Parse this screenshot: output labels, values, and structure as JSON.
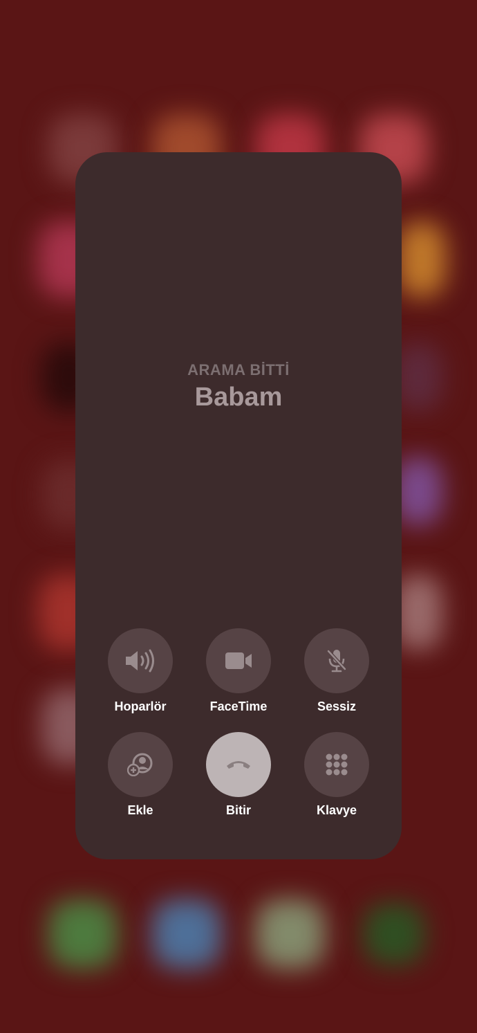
{
  "call": {
    "status": "ARAMA BİTTİ",
    "caller_name": "Babam"
  },
  "controls": [
    {
      "label": "Hoparlör",
      "icon": "speaker-icon"
    },
    {
      "label": "FaceTime",
      "icon": "video-camera-icon"
    },
    {
      "label": "Sessiz",
      "icon": "microphone-muted-icon"
    },
    {
      "label": "Ekle",
      "icon": "add-call-icon"
    },
    {
      "label": "Bitir",
      "icon": "end-call-icon"
    },
    {
      "label": "Klavye",
      "icon": "keypad-icon"
    }
  ],
  "colors": {
    "background": "#5a1515",
    "card": "#3d2b2c",
    "button": "#564345",
    "end_button": "#bdb4b5",
    "icon": "#9a8c8e"
  }
}
